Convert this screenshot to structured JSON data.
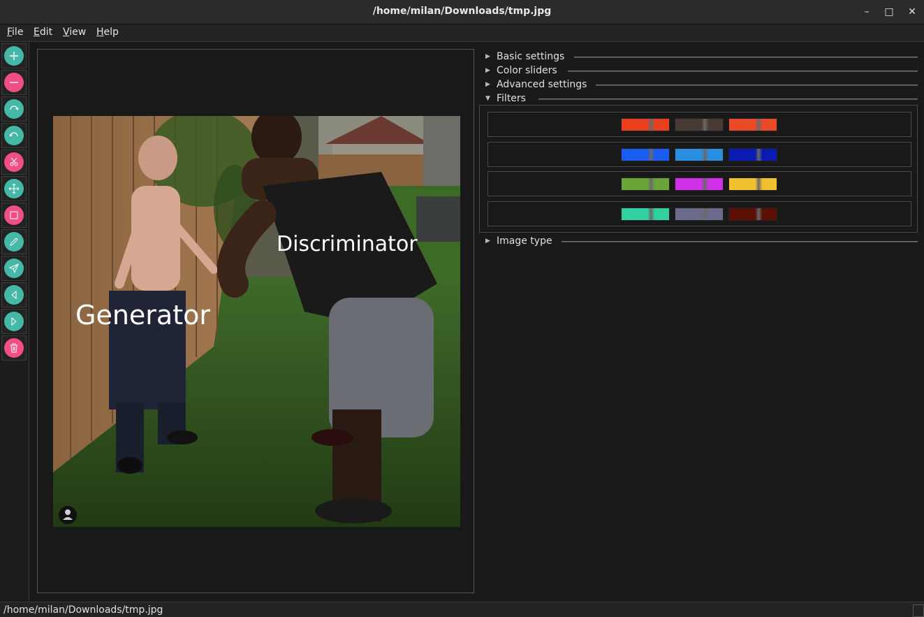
{
  "window": {
    "title": "/home/milan/Downloads/tmp.jpg",
    "minimize_glyph": "–",
    "maximize_glyph": "□",
    "close_glyph": "✕"
  },
  "menu": [
    {
      "mnemonic": "F",
      "rest": "ile"
    },
    {
      "mnemonic": "E",
      "rest": "dit"
    },
    {
      "mnemonic": "V",
      "rest": "iew"
    },
    {
      "mnemonic": "H",
      "rest": "elp"
    }
  ],
  "toolbar": {
    "buttons": [
      {
        "icon": "zoom-in-icon",
        "color": "#46b8a8"
      },
      {
        "icon": "zoom-out-icon",
        "color": "#ef4f83"
      },
      {
        "icon": "rotate-right-icon",
        "color": "#46b8a8"
      },
      {
        "icon": "rotate-left-icon",
        "color": "#46b8a8"
      },
      {
        "icon": "cut-icon",
        "color": "#ef4f83"
      },
      {
        "icon": "move-icon",
        "color": "#46b8a8"
      },
      {
        "icon": "crop-icon",
        "color": "#ef4f83"
      },
      {
        "icon": "pencil-icon",
        "color": "#46b8a8"
      },
      {
        "icon": "send-icon",
        "color": "#46b8a8"
      },
      {
        "icon": "previous-icon",
        "color": "#46b8a8"
      },
      {
        "icon": "next-icon",
        "color": "#46b8a8"
      },
      {
        "icon": "delete-icon",
        "color": "#ef4f83"
      }
    ]
  },
  "image": {
    "caption_right": "Discriminator",
    "caption_left": "Generator"
  },
  "panel": {
    "sections": {
      "basic": "Basic settings",
      "color": "Color sliders",
      "advanced": "Advanced settings",
      "filters": "Filters",
      "image_type": "Image type"
    },
    "filter_rows": [
      [
        "#e8401f",
        "#4a3a36",
        "#e84a2a"
      ],
      [
        "#1a5cf0",
        "#2a8ee0",
        "#0a1ab0"
      ],
      [
        "#6aa53a",
        "#d030e8",
        "#f0c030"
      ],
      [
        "#30d0a0",
        "#6a6a8a",
        "#5a1005"
      ]
    ]
  },
  "status": {
    "path": "/home/milan/Downloads/tmp.jpg"
  }
}
